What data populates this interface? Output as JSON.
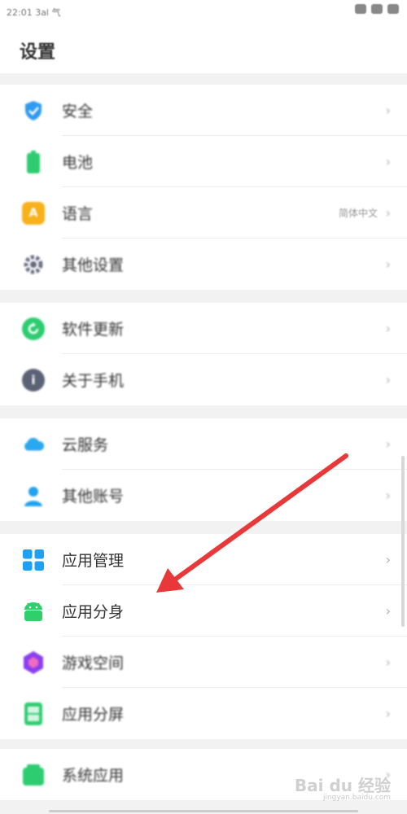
{
  "status_bar": {
    "left_text": "22:01 3al 气",
    "right_icons": [
      "eye-icon",
      "wifi-icon",
      "battery-icon"
    ]
  },
  "header": {
    "title": "设置"
  },
  "groups": [
    {
      "items": [
        {
          "label": "安全",
          "icon": "shield-icon",
          "color": "#2f9bf0"
        },
        {
          "label": "电池",
          "icon": "battery-icon",
          "color": "#2ecc71"
        },
        {
          "label": "语言",
          "icon": "language-icon",
          "color": "#f7b21b",
          "value": "简体中文"
        },
        {
          "label": "其他设置",
          "icon": "gear-icon",
          "color": "#666a80"
        }
      ]
    },
    {
      "items": [
        {
          "label": "软件更新",
          "icon": "update-icon",
          "color": "#2ecc71"
        },
        {
          "label": "关于手机",
          "icon": "info-icon",
          "color": "#5c6275"
        }
      ]
    },
    {
      "items": [
        {
          "label": "云服务",
          "icon": "cloud-icon",
          "color": "#29a8f0"
        },
        {
          "label": "其他账号",
          "icon": "person-icon",
          "color": "#22a1ee"
        }
      ]
    },
    {
      "items": [
        {
          "label": "应用管理",
          "icon": "app-grid-icon",
          "color": "#1ea1f2"
        },
        {
          "label": "应用分身",
          "icon": "android-icon",
          "color": "#2fcf6c"
        },
        {
          "label": "游戏空间",
          "icon": "game-icon",
          "color": "#8a3ff0"
        },
        {
          "label": "应用分屏",
          "icon": "split-screen-icon",
          "color": "#2ecc71"
        }
      ]
    },
    {
      "items": [
        {
          "label": "系统应用",
          "icon": "system-apps-icon",
          "color": "#2ecc71"
        }
      ]
    }
  ],
  "chevron": "›",
  "annotation": {
    "arrow_color": "#e8383a"
  },
  "watermark": {
    "text": "Bai du 经验",
    "sub": "jingyan.baidu.com"
  }
}
